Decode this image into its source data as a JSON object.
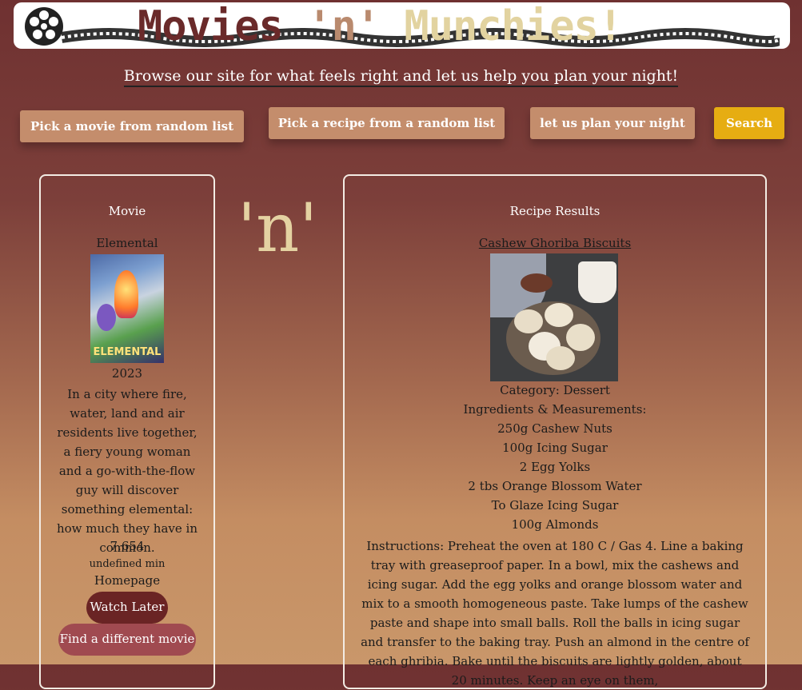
{
  "header": {
    "brand_movies": "Movies",
    "brand_n": "'n'",
    "brand_munchies": "Munchies!"
  },
  "tagline": "Browse our site for what feels right and let us help you plan your night!",
  "nav": {
    "random_movie": "Pick a movie from random list",
    "random_recipe": "Pick a recipe from a random list",
    "plan_night": "let us plan your night",
    "search": "Search"
  },
  "divider_n": "'n'",
  "movie": {
    "heading": "Movie",
    "title": "Elemental",
    "poster_text": "ELEMENTAL",
    "year": "2023",
    "description": "In a city where fire, water, land and air residents live together, a fiery young woman and a go-with-the-flow guy will discover something elemental: how much they have in common.",
    "rating": "7.654",
    "runtime": "undefined min",
    "homepage": "Homepage",
    "watch_later": "Watch Later",
    "find_different": "Find a different movie"
  },
  "recipe": {
    "heading": "Recipe Results",
    "name": "Cashew Ghoriba Biscuits",
    "category": "Category: Dessert",
    "ingredients_label": "Ingredients & Measurements:",
    "ingredients": [
      "250g Cashew Nuts",
      "100g Icing Sugar",
      "2 Egg Yolks",
      "2 tbs Orange Blossom Water",
      "To Glaze Icing Sugar",
      "100g Almonds"
    ],
    "instructions": "Instructions: Preheat the oven at 180 C / Gas 4. Line a baking tray with greaseproof paper. In a bowl, mix the cashews and icing sugar. Add the egg yolks and orange blossom water and mix to a smooth homogeneous paste. Take lumps of the cashew paste and shape into small balls. Roll the balls in icing sugar and transfer to the baking tray. Push an almond in the centre of each ghribia. Bake until the biscuits are lightly golden, about 20 minutes. Keep an eye on them,"
  },
  "colors": {
    "accent_button": "#c48d6c",
    "search_button": "#e6ad12",
    "watch_later_bg": "#6a2424",
    "find_different_bg": "#a04a50"
  }
}
